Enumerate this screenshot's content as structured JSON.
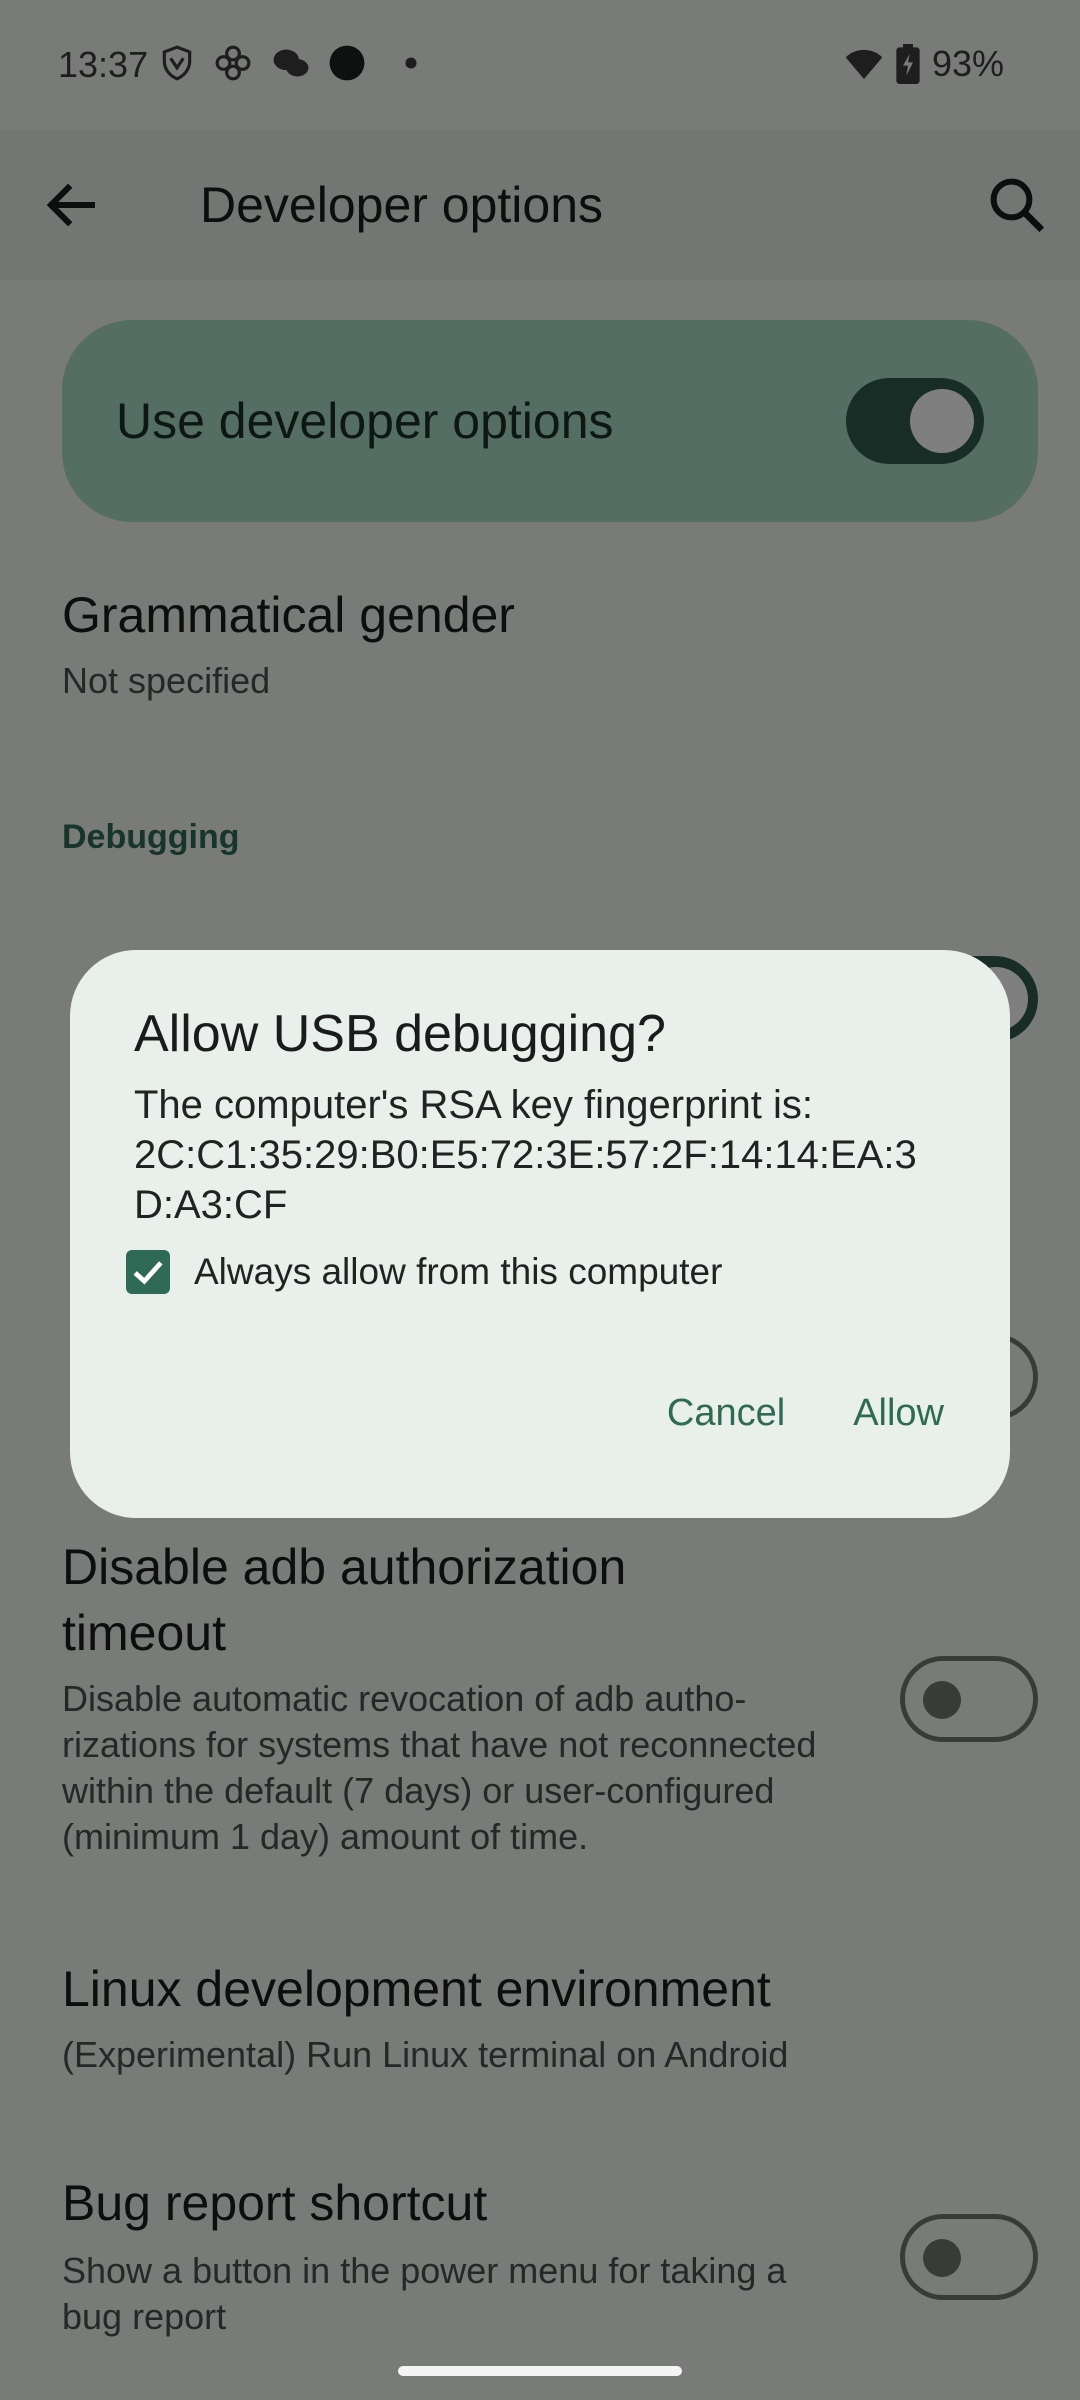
{
  "status_bar": {
    "time": "13:37",
    "battery": "93%",
    "icons": [
      "vpn-shield-icon",
      "pinwheel-app-icon",
      "wechat-icon",
      "dark-circle-icon",
      "dot-icon",
      "wifi-icon",
      "battery-charging-icon"
    ]
  },
  "app_bar": {
    "title": "Developer options",
    "back_icon": "arrow-left-icon",
    "search_icon": "search-icon"
  },
  "master_toggle": {
    "label": "Use developer options",
    "state": "on"
  },
  "prefs": {
    "grammatical_gender": {
      "title": "Grammatical gender",
      "summary": "Not specified"
    },
    "section_debugging": "Debugging",
    "disable_adb_timeout": {
      "title_line1": "Disable adb authorization",
      "title_line2": "timeout",
      "summary_line1": "Disable automatic revocation of adb autho-",
      "summary_line2": "rizations for systems that have not reconnected",
      "summary_line3": "within the default (7 days) or user-configured",
      "summary_line4": "(minimum 1 day) amount of time.",
      "state": "off"
    },
    "linux_env": {
      "title": "Linux development environment",
      "summary": "(Experimental) Run Linux terminal on Android"
    },
    "bug_report": {
      "title": "Bug report shortcut",
      "summary_line1": "Show a button in the power menu for taking a",
      "summary_line2": "bug report",
      "state": "off"
    }
  },
  "dialog": {
    "title": "Allow USB debugging?",
    "body_line1": "The computer's RSA key fingerprint is:",
    "body_line2": "2C:C1:35:29:B0:E5:72:3E:57:2F:14:14:EA:3",
    "body_line3": "D:A3:CF",
    "checkbox_label": "Always allow from this computer",
    "checkbox_checked": true,
    "cancel_label": "Cancel",
    "allow_label": "Allow"
  },
  "colors": {
    "accent": "#2f6a55",
    "card": "#a9dcc8",
    "dialog_bg": "#e9efeb"
  }
}
